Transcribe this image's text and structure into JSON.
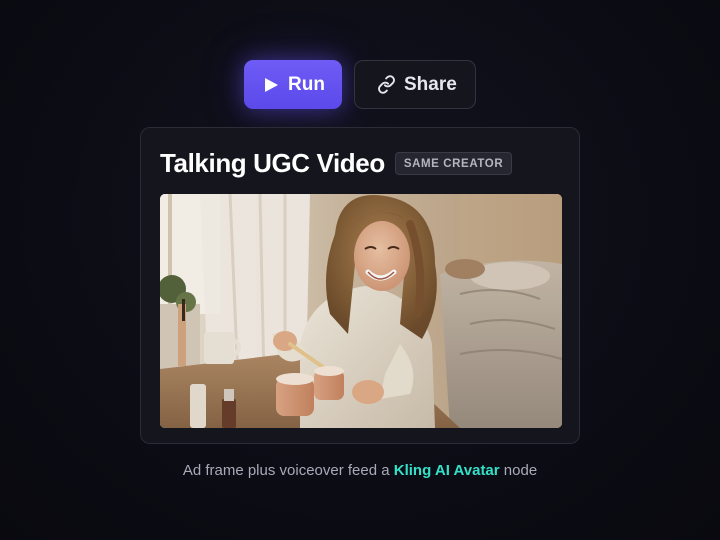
{
  "toolbar": {
    "run_label": "Run",
    "share_label": "Share",
    "run_icon": "play-icon",
    "share_icon": "link-icon"
  },
  "card": {
    "title": "Talking UGC Video",
    "badge": "SAME CREATOR"
  },
  "caption": {
    "prefix": "Ad frame plus voiceover feed a ",
    "highlight": "Kling AI Avatar",
    "suffix": " node"
  },
  "colors": {
    "accent": "#5b49ea",
    "highlight": "#34e0c8",
    "background": "#0b0b13",
    "card": "#15151d"
  }
}
